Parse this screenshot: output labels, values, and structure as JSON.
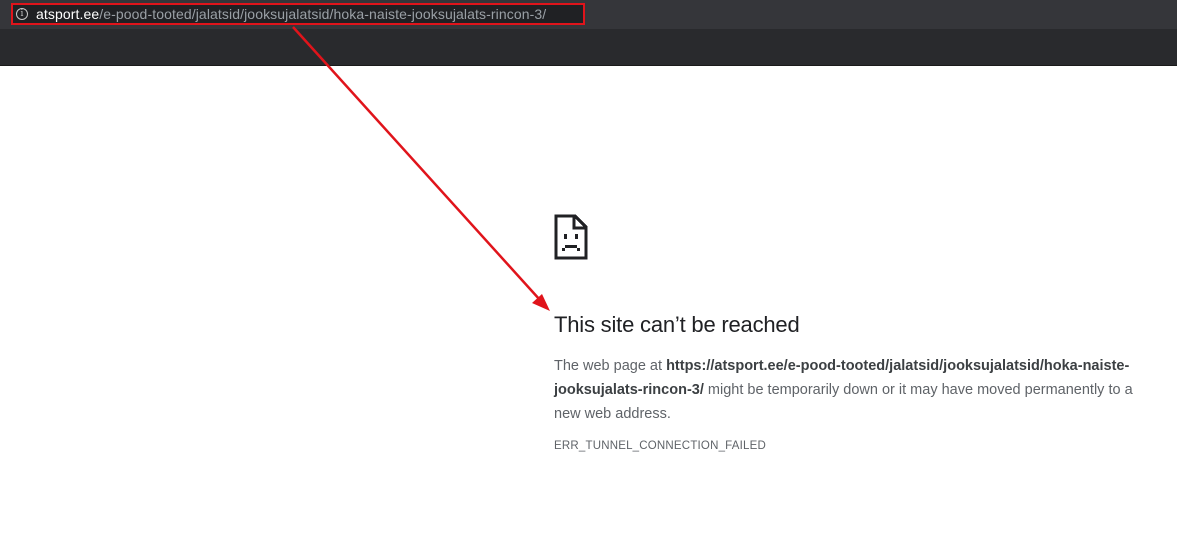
{
  "address_bar": {
    "icon": "info-icon",
    "host": "atsport.ee",
    "path": "/e-pood-tooted/jalatsid/jooksujalatsid/hoka-naiste-jooksujalats-rincon-3/"
  },
  "error_page": {
    "icon": "sad-page-icon",
    "title": "This site can’t be reached",
    "desc_prefix": "The web page at ",
    "url": "https://atsport.ee/e-pood-tooted/jalatsid/jooksujalatsid/hoka-naiste-jooksujalats-rincon-3/",
    "desc_suffix": " might be temporarily down or it may have moved permanently to a new web address.",
    "error_code": "ERR_TUNNEL_CONNECTION_FAILED"
  },
  "annotation": {
    "highlight_color": "#e0141b"
  }
}
